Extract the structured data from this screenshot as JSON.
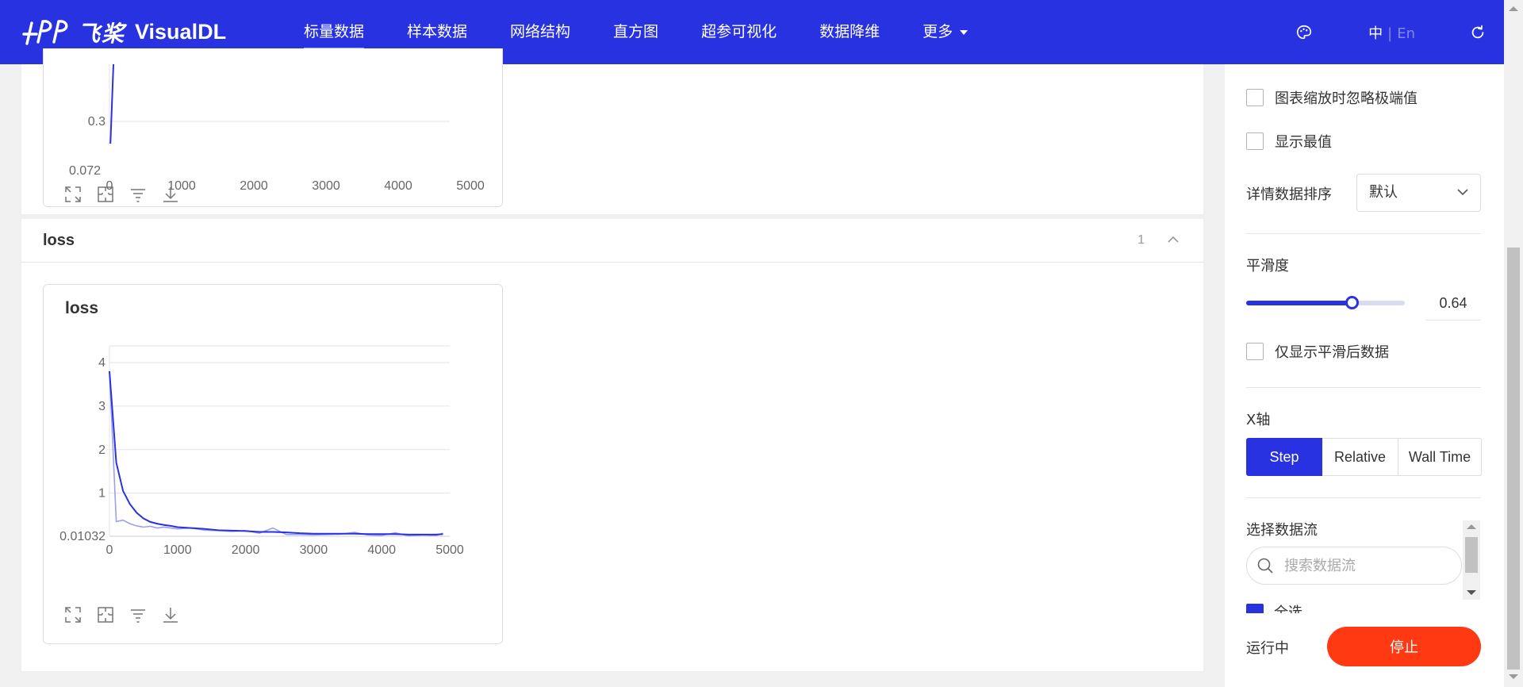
{
  "header": {
    "logo_cn": "飞桨",
    "logo_en": "VisualDL",
    "nav": [
      {
        "label": "标量数据",
        "active": true
      },
      {
        "label": "样本数据"
      },
      {
        "label": "网络结构"
      },
      {
        "label": "直方图"
      },
      {
        "label": "超参可视化"
      },
      {
        "label": "数据降维"
      },
      {
        "label": "更多"
      }
    ],
    "lang_zh": "中",
    "lang_sep": "|",
    "lang_en": "En",
    "icons": [
      "palette-icon",
      "refresh-icon"
    ]
  },
  "main": {
    "top_chart": {
      "y_ticks": [
        "0.3",
        "0.072"
      ],
      "x_ticks": [
        "0",
        "1000",
        "2000",
        "3000",
        "4000",
        "5000"
      ]
    },
    "group": {
      "title": "loss",
      "count": "1"
    },
    "loss_chart": {
      "title": "loss"
    },
    "tool_icons": [
      "maximize-icon",
      "fit-icon",
      "filter-icon",
      "download-icon"
    ]
  },
  "chart_data": [
    {
      "type": "line",
      "title": "",
      "x": [
        0,
        50
      ],
      "series": [
        {
          "values": [
            0.072,
            0.35
          ]
        }
      ],
      "xlim": [
        0,
        5000
      ],
      "y_tick_labels": [
        "0.3",
        "0.072"
      ]
    },
    {
      "type": "line",
      "title": "loss",
      "xlim": [
        0,
        5000
      ],
      "ylim": [
        0.01032,
        4.2
      ],
      "x_tick_labels": [
        "0",
        "1000",
        "2000",
        "3000",
        "4000",
        "5000"
      ],
      "y_tick_labels": [
        "4",
        "3",
        "2",
        "1",
        "0.01032"
      ],
      "x": [
        0,
        100,
        200,
        300,
        400,
        500,
        600,
        700,
        800,
        900,
        1000,
        1200,
        1400,
        1600,
        1800,
        2000,
        2200,
        2400,
        2600,
        2800,
        3000,
        3200,
        3400,
        3600,
        3800,
        4000,
        4200,
        4400,
        4600,
        4800,
        4900
      ],
      "series": [
        {
          "values": [
            3.8,
            1.7,
            1.05,
            0.75,
            0.55,
            0.42,
            0.34,
            0.3,
            0.27,
            0.25,
            0.22,
            0.2,
            0.18,
            0.15,
            0.14,
            0.13,
            0.11,
            0.11,
            0.1,
            0.08,
            0.07,
            0.07,
            0.07,
            0.07,
            0.06,
            0.06,
            0.06,
            0.05,
            0.05,
            0.05,
            0.06
          ]
        },
        {
          "values": [
            3.8,
            0.35,
            0.38,
            0.3,
            0.25,
            0.22,
            0.24,
            0.2,
            0.22,
            0.2,
            0.18,
            0.2,
            0.15,
            0.14,
            0.12,
            0.14,
            0.08,
            0.2,
            0.05,
            0.05,
            0.04,
            0.05,
            0.06,
            0.1,
            0.04,
            0.03,
            0.09,
            0.02,
            0.04,
            0.03,
            0.08
          ]
        }
      ]
    }
  ],
  "sidebar": {
    "ignore_outliers": "图表缩放时忽略极端值",
    "show_extremes": "显示最值",
    "sort_label": "详情数据排序",
    "sort_value": "默认",
    "smoothing_label": "平滑度",
    "smoothing_value": "0.64",
    "smoothing_fraction": 0.64,
    "only_smoothed": "仅显示平滑后数据",
    "xaxis_label": "X轴",
    "xaxis_options": [
      "Step",
      "Relative",
      "Wall Time"
    ],
    "xaxis_selected": "Step",
    "stream_label": "选择数据流",
    "search_placeholder": "搜索数据流",
    "partial_item": "全选",
    "status": "运行中",
    "stop_label": "停止"
  },
  "colors": {
    "brand": "#2932e1",
    "stop": "#ff3912",
    "line_smoothed": "#2932e1",
    "line_raw": "#9a9ff0"
  }
}
